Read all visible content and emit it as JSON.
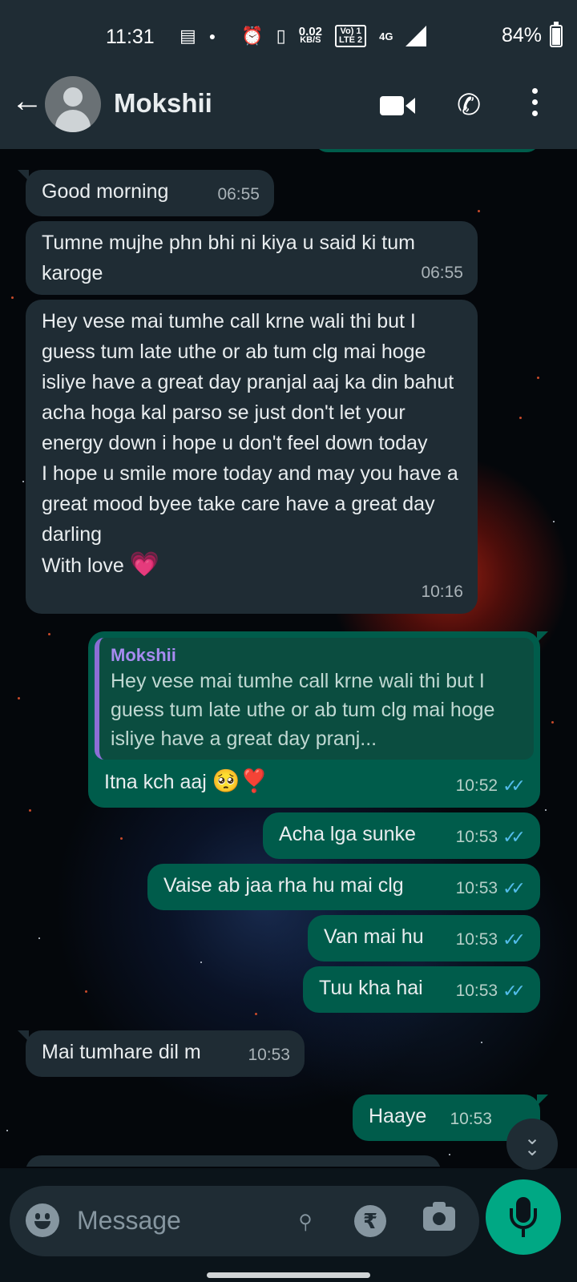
{
  "status_bar": {
    "time": "11:31",
    "net_speed_value": "0.02",
    "net_speed_unit": "KB/S",
    "carrier_top": "Vo) 1",
    "carrier_bottom": "LTE 2",
    "network": "4G",
    "battery": "84%"
  },
  "header": {
    "contact_name": "Mokshii"
  },
  "messages": [
    {
      "direction": "incoming",
      "text": "Good morning",
      "time": "06:55"
    },
    {
      "direction": "incoming",
      "text": "Tumne mujhe phn bhi ni kiya u said ki tum karoge",
      "time": "06:55"
    },
    {
      "direction": "incoming",
      "text": "Hey vese mai tumhe call krne wali thi but I guess tum late uthe or ab tum clg mai hoge isliye have a great day pranjal aaj ka din bahut acha hoga kal parso se just don't let your energy down i hope u don't feel down today\nI hope u smile more today and may you have a great mood byee take care have a great day darling\nWith love",
      "emoji": "💗",
      "time": "10:16"
    },
    {
      "direction": "outgoing",
      "quoted_author": "Mokshii",
      "quoted_text": "Hey vese mai tumhe call krne wali thi but I guess tum late uthe or ab tum clg mai hoge isliye have a great day pranj...",
      "text": "Itna kch aaj",
      "emoji": "🥺❣️",
      "time": "10:52"
    },
    {
      "direction": "outgoing",
      "text": "Acha lga sunke",
      "time": "10:53"
    },
    {
      "direction": "outgoing",
      "text": "Vaise ab jaa rha hu mai clg",
      "time": "10:53"
    },
    {
      "direction": "outgoing",
      "text": "Van mai hu",
      "time": "10:53"
    },
    {
      "direction": "outgoing",
      "text": "Tuu kha hai",
      "time": "10:53"
    },
    {
      "direction": "incoming",
      "text": "Mai tumhare dil m",
      "time": "10:53"
    },
    {
      "direction": "outgoing",
      "text": "Haaye",
      "time": "10:53"
    }
  ],
  "composer": {
    "placeholder": "Message",
    "value": ""
  },
  "colors": {
    "header_bg": "#1f2c34",
    "incoming_bubble": "#1f2c34",
    "outgoing_bubble": "#005c4b",
    "accent": "#00a884",
    "read_ticks": "#53bdeb"
  },
  "icons": {
    "back": "arrow-left-icon",
    "video": "video-call-icon",
    "call": "phone-icon",
    "menu": "more-vert-icon",
    "emoji": "emoji-icon",
    "attach": "paperclip-icon",
    "payment": "rupee-icon",
    "camera": "camera-icon",
    "mic": "mic-icon",
    "scroll": "double-chevron-down-icon"
  }
}
